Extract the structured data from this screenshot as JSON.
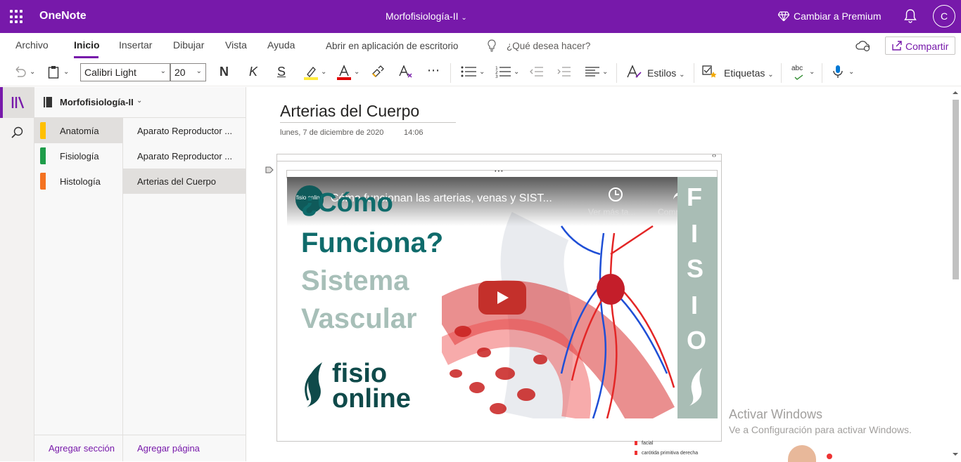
{
  "topbar": {
    "app_name": "OneNote",
    "notebook_title": "Morfofisiología-II",
    "premium_label": "Cambiar a Premium",
    "avatar_initial": "C",
    "accent_color": "#7719aa"
  },
  "menu": {
    "items": [
      "Archivo",
      "Inicio",
      "Insertar",
      "Dibujar",
      "Vista",
      "Ayuda"
    ],
    "open_desktop": "Abrir en aplicación de escritorio",
    "search_placeholder": "¿Qué desea hacer?",
    "share_label": "Compartir"
  },
  "toolbar": {
    "font_name": "Calibri Light",
    "font_size": "20",
    "bold": "N",
    "italic": "K",
    "underline": "S",
    "styles_label": "Estilos",
    "tags_label": "Etiquetas",
    "spell_label": "abc"
  },
  "navigation": {
    "notebook_name": "Morfofisiología-II",
    "sections": [
      {
        "label": "Anatomía",
        "color": "#ffc000"
      },
      {
        "label": "Fisiología",
        "color": "#1e9d4a"
      },
      {
        "label": "Histología",
        "color": "#f47220"
      }
    ],
    "pages": [
      "Aparato Reproductor ...",
      "Aparato Reproductor ...",
      "Arterias del Cuerpo"
    ],
    "add_section": "Agregar sección",
    "add_page": "Agregar página"
  },
  "page": {
    "title": "Arterias del Cuerpo",
    "date": "lunes, 7 de diciembre de 2020",
    "time": "14:06"
  },
  "video": {
    "title": "Cómo funcionan las arterias, venas y SIST...",
    "channel_badge": "fisio online",
    "watch_later": "Ver más ta...",
    "share": "Compartir",
    "heading_line1": "¿Cómo",
    "heading_line2": "Funciona?",
    "heading_line3": "Sistema",
    "heading_line4": "Vascular",
    "brand_line1": "fisio",
    "brand_line2": "online",
    "side_letters": [
      "F",
      "I",
      "S",
      "I",
      "O"
    ]
  },
  "watermark": {
    "line1": "Activar Windows",
    "line2": "Ve a Configuración para activar Windows."
  },
  "below_image": {
    "label1": "facial",
    "label2": "carótida primitiva derecha"
  }
}
